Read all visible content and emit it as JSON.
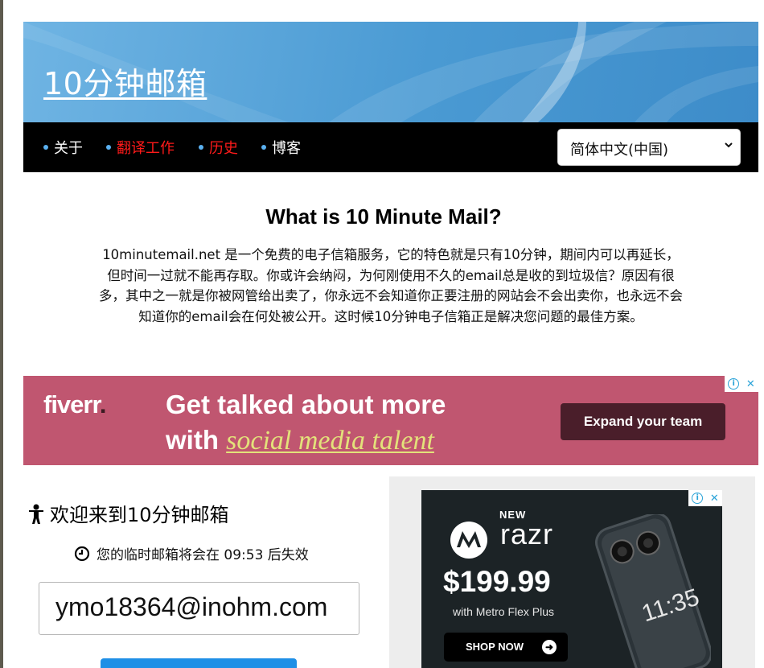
{
  "site": {
    "title": "10分钟邮箱"
  },
  "nav": {
    "items": [
      {
        "label": "关于",
        "color": "#ffffff"
      },
      {
        "label": "翻译工作",
        "color": "#ff1a1a"
      },
      {
        "label": "历史",
        "color": "#ff1a1a"
      },
      {
        "label": "博客",
        "color": "#ffffff"
      }
    ],
    "language_selected": "简体中文(中国)"
  },
  "intro": {
    "title": "What is 10 Minute Mail?",
    "text": "10minutemail.net 是一个免费的电子信箱服务，它的特色就是只有10分钟，期间内可以再延长，但时间一过就不能再存取。你或许会纳闷，为何刚使用不久的email总是收的到垃圾信？原因有很多，其中之一就是你被网管给出卖了，你永远不会知道你正要注册的网站会不会出卖你，也永远不会知道你的email会在何处被公开。这时候10分钟电子信箱正是解决您问题的最佳方案。"
  },
  "ad_fiverr": {
    "logo": "fiverr",
    "logo_dot": ".",
    "headline_line1": "Get talked about more",
    "headline_line2_prefix": "with ",
    "headline_highlight": "social media talent",
    "cta": "Expand your team",
    "background": "#c05670",
    "adchoices_close": "✕",
    "adchoices_info": "i"
  },
  "mailbox": {
    "welcome": "欢迎来到10分钟邮箱",
    "expire_text": "您的临时邮箱将会在 09:53 后失效",
    "email": "ymo18364@inohm.com"
  },
  "ad_razr": {
    "new_label": "NEW",
    "product": "razr",
    "price": "$199.99",
    "plan": "with Metro Flex Plus",
    "cta": "SHOP NOW",
    "phone_time": "11:35",
    "adchoices_close": "✕",
    "adchoices_info": "i"
  },
  "colors": {
    "header_blue": "#4a9ad3",
    "nav_bg": "#000000",
    "nav_bullet": "#5ab0f0",
    "button_blue": "#1e8fe6"
  }
}
